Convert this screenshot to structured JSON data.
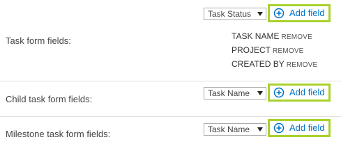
{
  "rows": [
    {
      "label": "Task form fields:",
      "select_value": "Task Status",
      "add_label": "Add field",
      "fields": [
        {
          "name": "TASK NAME",
          "remove": "REMOVE"
        },
        {
          "name": "PROJECT",
          "remove": "REMOVE"
        },
        {
          "name": "CREATED BY",
          "remove": "REMOVE"
        }
      ]
    },
    {
      "label": "Child task form fields:",
      "select_value": "Task Name",
      "add_label": "Add field"
    },
    {
      "label": "Milestone task form fields:",
      "select_value": "Task Name",
      "add_label": "Add field"
    }
  ],
  "colors": {
    "highlight_border": "#a9d12c",
    "link": "#0072c6"
  },
  "icons": {
    "add": "plus-circle-icon",
    "dropdown": "chevron-down-icon"
  }
}
